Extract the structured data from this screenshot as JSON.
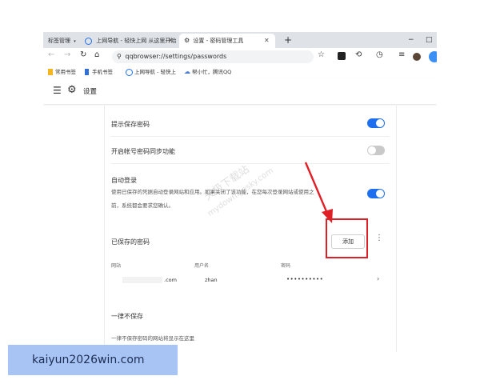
{
  "browser": {
    "tabs": [
      {
        "label": "标签管理",
        "icon": "chevron-down-icon"
      },
      {
        "label": "上网导航 - 轻快上网 从这里开始",
        "icon": "qq-browser-icon"
      },
      {
        "label": "设置 - 密码管理工具",
        "icon": "gear-icon",
        "active": true
      }
    ],
    "new_tab_symbol": "+",
    "window_controls": [
      "−",
      "□"
    ],
    "address": "qqbrowser://settings/passwords",
    "bookmarks": [
      {
        "label": "常用书签",
        "icon": "bookmark-yellow-icon"
      },
      {
        "label": "手机书签",
        "icon": "bookmark-blue-icon"
      },
      {
        "label": "上网导航 - 轻快上",
        "icon": "qq-browser-icon"
      },
      {
        "label": "帮小忙，腾讯QQ",
        "icon": "cloud-icon"
      }
    ]
  },
  "settings": {
    "title": "设置",
    "offer_save_label": "提示保存密码",
    "offer_save_on": true,
    "sync_label": "开启帐号密码同步功能",
    "sync_on": false,
    "auto_login_title": "自动登录",
    "auto_login_desc_1": "使用已保存的凭据自动登录网站和应用。如果关闭了该功能，在您每次登录网站或使用之",
    "auto_login_desc_2": "前，系统都会要求您确认。",
    "auto_login_on": true,
    "saved_title": "已保存的密码",
    "add_button": "添加",
    "columns": [
      "网站",
      "用户名",
      "密码"
    ],
    "saved_rows": [
      {
        "site": ".com",
        "user": "zhan",
        "password": "••••••••••"
      }
    ],
    "never_title": "一律不保存",
    "never_desc": "一律不保存密码的网站将显示在这里"
  },
  "watermark": {
    "text": "kaiyun2026win.com",
    "site_cn": "天极下载站",
    "site_en": "mydown.yesky.com"
  },
  "colors": {
    "accent": "#1e6ff0",
    "annotation": "#e01e26",
    "overlay": "#a8c4f4"
  }
}
